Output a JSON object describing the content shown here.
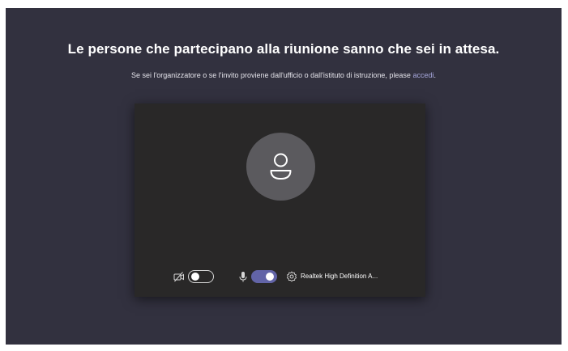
{
  "lobby": {
    "title": "Le persone che partecipano alla riunione sanno che sei in attesa.",
    "subtitle_text": "Se sei l'organizzatore o se l'invito proviene dall'ufficio o dall'istituto di istruzione, please ",
    "subtitle_link": "accedi",
    "subtitle_end": "."
  },
  "preview": {
    "avatar_icon": "person-icon",
    "camera": {
      "icon": "camera-off-icon",
      "enabled": false
    },
    "microphone": {
      "icon": "microphone-icon",
      "enabled": true
    },
    "device_settings_icon": "gear-icon",
    "audio_device_label": "Realtek High Definition A..."
  },
  "colors": {
    "background": "#32313f",
    "preview_background": "#292828",
    "accent": "#6264a7",
    "link": "#a6a7dc",
    "avatar": "#5b5a5e"
  }
}
